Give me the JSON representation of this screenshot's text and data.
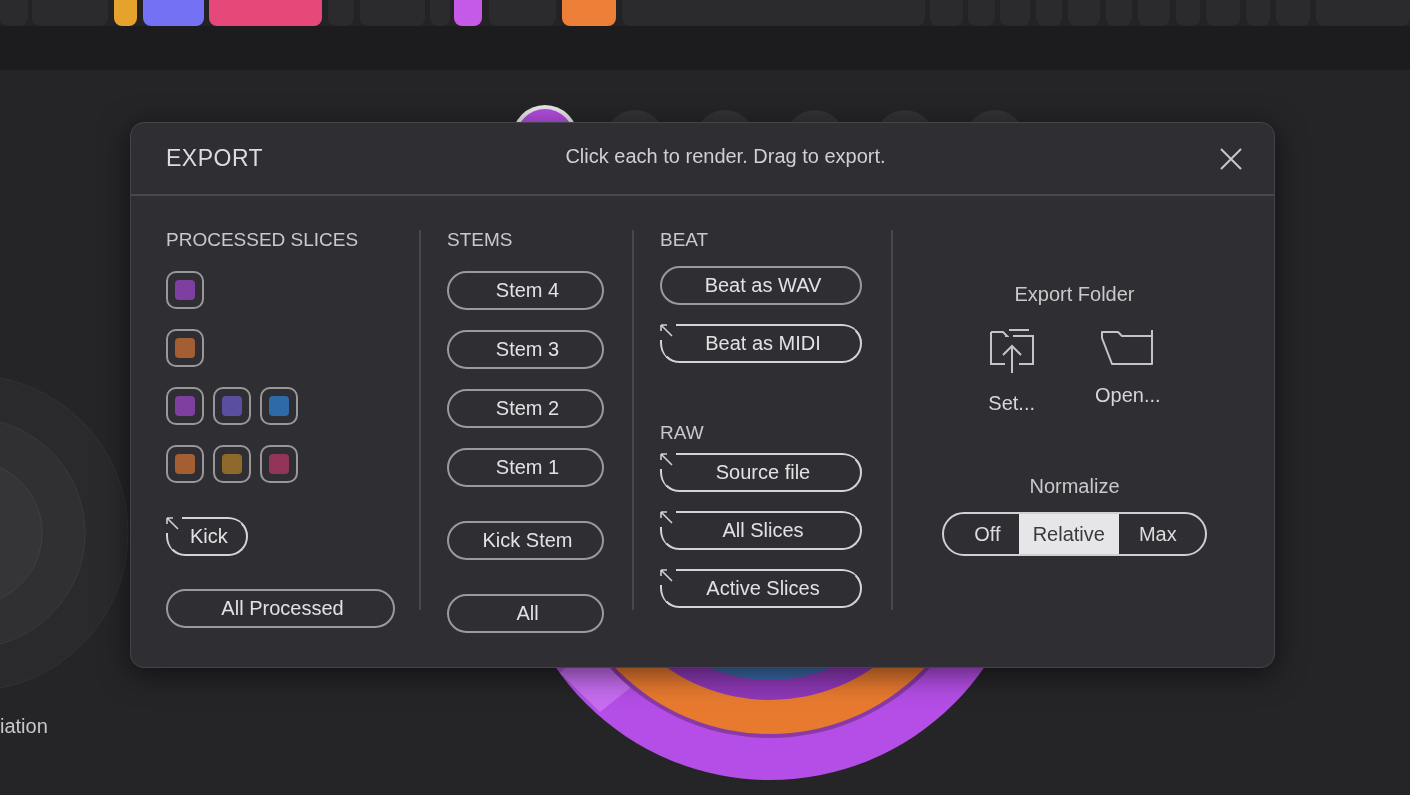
{
  "background": {
    "label": "iation"
  },
  "dialog": {
    "title": "EXPORT",
    "hint": "Click each to render. Drag to export.",
    "columns": [
      {
        "sections": [
          {
            "heading": "PROCESSED SLICES",
            "swatch_rows": [
              [
                {
                  "color": "#7e3fa0"
                }
              ],
              [
                {
                  "color": "#a45e33"
                }
              ],
              [
                {
                  "color": "#7e3fa0"
                },
                {
                  "color": "#5a4ea0"
                },
                {
                  "color": "#2f6aa8"
                }
              ],
              [
                {
                  "color": "#a45e33"
                },
                {
                  "color": "#8d6a2a"
                },
                {
                  "color": "#93345a"
                }
              ]
            ],
            "button_groups": [
              [
                {
                  "label": "Kick",
                  "kind": "drag"
                }
              ],
              [
                {
                  "label": "All Processed",
                  "kind": "plain"
                }
              ]
            ]
          }
        ]
      },
      {
        "sections": [
          {
            "heading": "STEMS",
            "button_groups": [
              [
                {
                  "label": "Stem 4",
                  "kind": "plain"
                },
                {
                  "label": "Stem 3",
                  "kind": "plain"
                },
                {
                  "label": "Stem 2",
                  "kind": "plain"
                },
                {
                  "label": "Stem 1",
                  "kind": "plain"
                }
              ],
              [
                {
                  "label": "Kick Stem",
                  "kind": "plain"
                },
                {
                  "label": "All",
                  "kind": "plain"
                }
              ]
            ]
          }
        ]
      },
      {
        "sections": [
          {
            "heading": "BEAT",
            "button_groups": [
              [
                {
                  "label": "Beat as WAV",
                  "kind": "plain"
                },
                {
                  "label": "Beat as MIDI",
                  "kind": "drag"
                }
              ]
            ]
          },
          {
            "heading": "RAW",
            "button_groups": [
              [
                {
                  "label": "Source file",
                  "kind": "drag"
                },
                {
                  "label": "All Slices",
                  "kind": "drag"
                },
                {
                  "label": "Active Slices",
                  "kind": "drag"
                }
              ]
            ]
          }
        ]
      }
    ],
    "export_folder": {
      "label": "Export Folder",
      "actions": [
        {
          "label": "Set...",
          "kind": "set"
        },
        {
          "label": "Open...",
          "kind": "open"
        }
      ]
    },
    "normalize": {
      "label": "Normalize",
      "options": [
        {
          "label": "Off",
          "selected": false
        },
        {
          "label": "Relative",
          "selected": true
        },
        {
          "label": "Max",
          "selected": false
        }
      ]
    }
  }
}
